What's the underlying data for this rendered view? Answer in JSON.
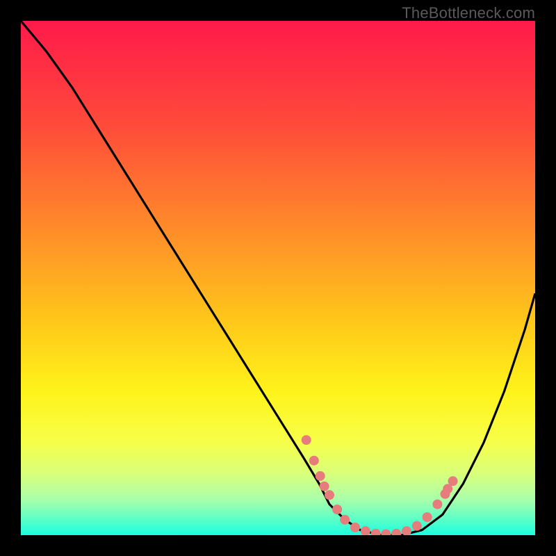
{
  "watermark": "TheBottleneck.com",
  "colors": {
    "background": "#000000",
    "curve": "#000000",
    "marker_fill": "#e77c7c",
    "marker_stroke": "#c55858"
  },
  "chart_data": {
    "type": "line",
    "title": "",
    "xlabel": "",
    "ylabel": "",
    "xlim": [
      0,
      100
    ],
    "ylim": [
      0,
      100
    ],
    "gradient_stops": [
      {
        "offset": 0.0,
        "color": "#ff1a4a"
      },
      {
        "offset": 0.2,
        "color": "#ff4a3a"
      },
      {
        "offset": 0.4,
        "color": "#ff8a2a"
      },
      {
        "offset": 0.58,
        "color": "#ffc61a"
      },
      {
        "offset": 0.72,
        "color": "#fff31a"
      },
      {
        "offset": 0.82,
        "color": "#f6ff4a"
      },
      {
        "offset": 0.88,
        "color": "#d9ff7a"
      },
      {
        "offset": 0.93,
        "color": "#aaffaa"
      },
      {
        "offset": 0.97,
        "color": "#5affc8"
      },
      {
        "offset": 1.0,
        "color": "#1affe0"
      }
    ],
    "series": [
      {
        "name": "bottleneck-curve",
        "x": [
          0,
          5,
          10,
          15,
          20,
          25,
          30,
          35,
          40,
          45,
          50,
          55,
          58,
          60,
          63,
          66,
          70,
          74,
          78,
          82,
          86,
          90,
          94,
          98,
          100
        ],
        "y": [
          100,
          94,
          87,
          79,
          71,
          63,
          55,
          47,
          39,
          31,
          23,
          15,
          10,
          6,
          3,
          1,
          0,
          0,
          1,
          4,
          10,
          18,
          28,
          40,
          47
        ]
      }
    ],
    "markers": [
      {
        "x": 55.5,
        "y": 18.5
      },
      {
        "x": 57.0,
        "y": 14.5
      },
      {
        "x": 58.2,
        "y": 11.5
      },
      {
        "x": 59.0,
        "y": 9.5
      },
      {
        "x": 60.0,
        "y": 7.8
      },
      {
        "x": 61.5,
        "y": 5.0
      },
      {
        "x": 63.0,
        "y": 3.0
      },
      {
        "x": 65.0,
        "y": 1.5
      },
      {
        "x": 67.0,
        "y": 0.8
      },
      {
        "x": 69.0,
        "y": 0.3
      },
      {
        "x": 71.0,
        "y": 0.2
      },
      {
        "x": 73.0,
        "y": 0.3
      },
      {
        "x": 75.0,
        "y": 0.8
      },
      {
        "x": 77.0,
        "y": 1.8
      },
      {
        "x": 79.0,
        "y": 3.5
      },
      {
        "x": 81.0,
        "y": 6.0
      },
      {
        "x": 83.0,
        "y": 9.0
      },
      {
        "x": 82.5,
        "y": 8.0
      },
      {
        "x": 84.0,
        "y": 10.5
      }
    ]
  }
}
